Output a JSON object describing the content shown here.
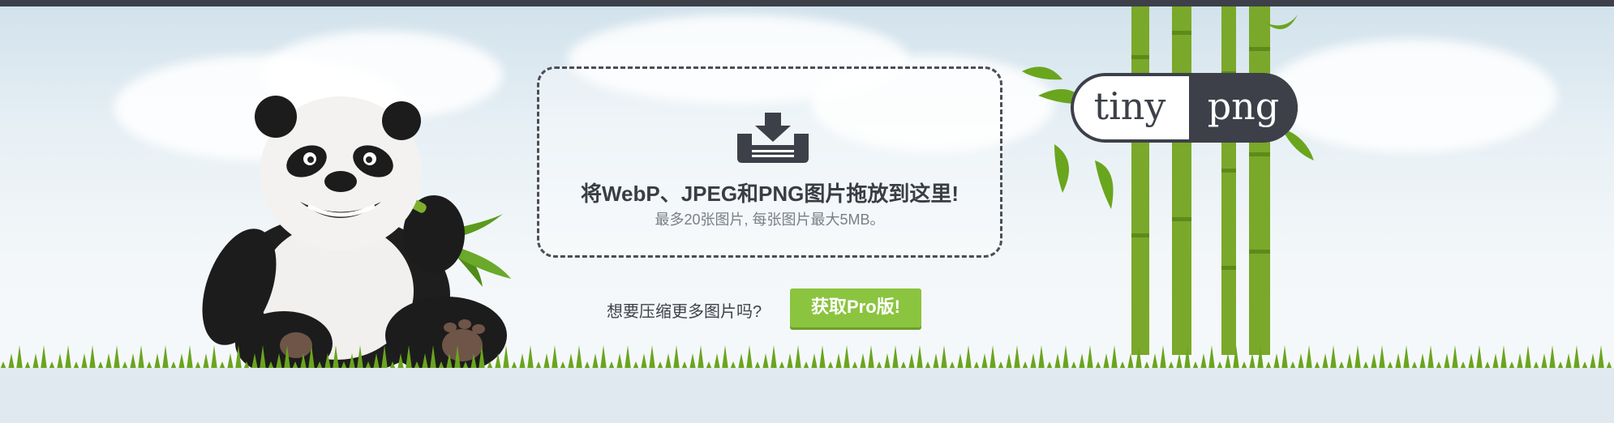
{
  "dropzone": {
    "title": "将WebP、JPEG和PNG图片拖放到这里!",
    "subtitle": "最多20张图片, 每张图片最大5MB。"
  },
  "promo": {
    "question": "想要压缩更多图片吗?",
    "button_label": "获取Pro版!"
  },
  "logo": {
    "left_text": "tiny",
    "right_text": "png"
  },
  "colors": {
    "brand_dark": "#3d4049",
    "button_green": "#8bc43f",
    "grass_green": "#6aa51e",
    "bamboo_green": "#7aa82a"
  },
  "icons": {
    "dropzone_icon": "download-tray-icon"
  }
}
